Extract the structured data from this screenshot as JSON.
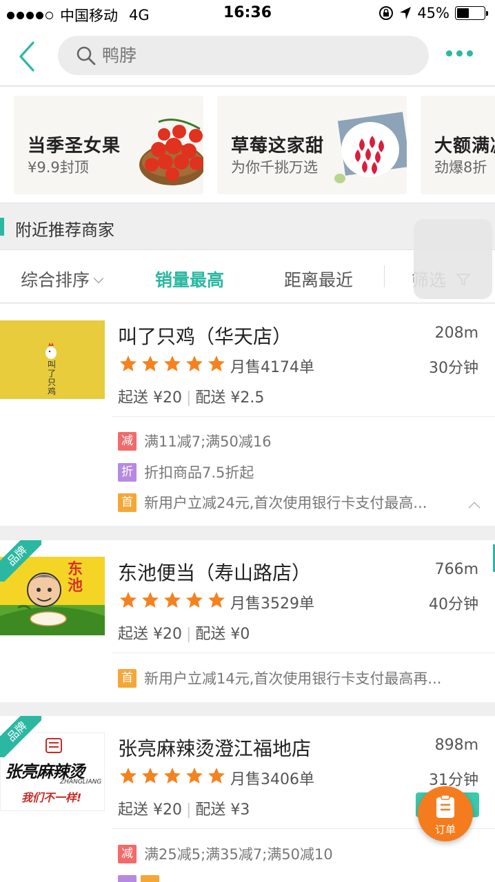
{
  "status_bar": {
    "carrier": "中国移动",
    "network": "4G",
    "time": "16:36",
    "battery": "45%",
    "battery_level": 0.45
  },
  "nav": {
    "search_placeholder": "鸭脖",
    "accent_color": "#2bb8a2"
  },
  "banners": [
    {
      "title": "当季圣女果",
      "subtitle": "¥9.9封顶"
    },
    {
      "title": "草莓这家甜",
      "subtitle": "为你千挑万选"
    },
    {
      "title": "大额满减",
      "subtitle": "劲爆8折"
    }
  ],
  "nearby": {
    "title": "附近推荐商家"
  },
  "sort": {
    "items": [
      "综合排序",
      "销量最高",
      "距离最近",
      "筛选"
    ],
    "active": "销量最高"
  },
  "shops": [
    {
      "name": "叫了只鸡（华天店）",
      "logo_text": "叫了只鸡",
      "distance": "208m",
      "rating_stars": 5,
      "monthly_sales": "月售4174单",
      "delivery_time": "30分钟",
      "min_order": "起送 ¥20",
      "delivery_fee": "配送 ¥2.5",
      "brand": false,
      "promos": [
        {
          "tag": "减",
          "text": "满11减7;满50减16"
        },
        {
          "tag": "折",
          "text": "折扣商品7.5折起"
        },
        {
          "tag": "首",
          "text": "新用户立减24元,首次使用银行卡支付最高..."
        }
      ]
    },
    {
      "name": "东池便当（寿山路店）",
      "logo_text": "东池",
      "brand_label": "品牌",
      "distance": "766m",
      "rating_stars": 5,
      "monthly_sales": "月售3529单",
      "delivery_time": "40分钟",
      "min_order": "起送 ¥20",
      "delivery_fee": "配送 ¥0",
      "brand": true,
      "promos": [
        {
          "tag": "首",
          "text": "新用户立减14元,首次使用银行卡支付最高再..."
        }
      ]
    },
    {
      "name": "张亮麻辣烫澄江福地店",
      "logo_text": "张亮麻辣烫",
      "logo_sub": "ZHANGLIANG",
      "logo_slogan": "我们不一样!",
      "brand_label": "品牌",
      "distance": "898m",
      "rating_stars": 5,
      "monthly_sales": "月售3406单",
      "delivery_time": "31分钟",
      "min_order": "起送 ¥20",
      "delivery_fee": "配送 ¥3",
      "brand": true,
      "promos": [
        {
          "tag": "减",
          "text": "满25减5;满35减7;满50减10"
        }
      ]
    }
  ],
  "order_button": {
    "label": "订单"
  }
}
